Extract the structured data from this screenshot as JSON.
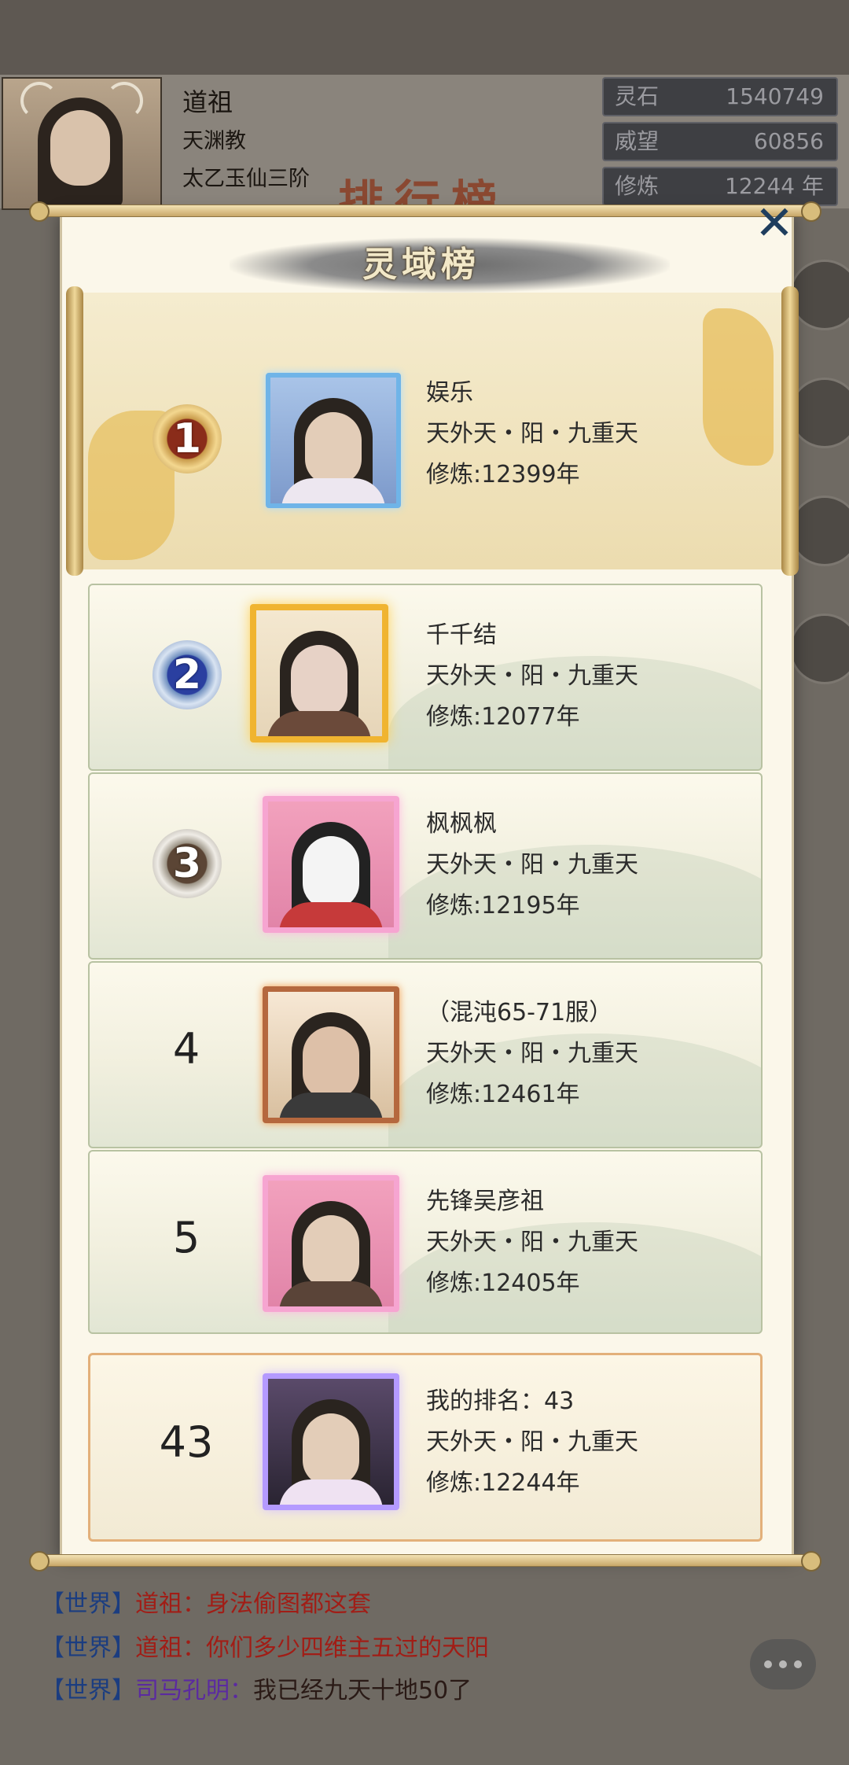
{
  "player": {
    "name": "道祖",
    "sect": "天渊教",
    "realm": "太乙玉仙三阶",
    "resources": [
      {
        "label": "灵石",
        "value": "1540749"
      },
      {
        "label": "威望",
        "value": "60856"
      },
      {
        "label": "修炼",
        "value": "12244 年"
      }
    ]
  },
  "background_title": "排行榜",
  "modal": {
    "title": "灵域榜",
    "close_icon": "close-x-icon",
    "entries": [
      {
        "rank": "1",
        "name": "娱乐",
        "realm": "天外天・阳・九重天",
        "cultivation": "修炼:12399年"
      },
      {
        "rank": "2",
        "name": "千千结",
        "realm": "天外天・阳・九重天",
        "cultivation": "修炼:12077年"
      },
      {
        "rank": "3",
        "name": "枫枫枫",
        "realm": "天外天・阳・九重天",
        "cultivation": "修炼:12195年"
      },
      {
        "rank": "4",
        "name": "（混沌65-71服）",
        "realm": "天外天・阳・九重天",
        "cultivation": "修炼:12461年"
      },
      {
        "rank": "5",
        "name": "先锋吴彦祖",
        "realm": "天外天・阳・九重天",
        "cultivation": "修炼:12405年"
      }
    ],
    "my_entry": {
      "rank": "43",
      "name": "我的排名：43",
      "realm": "天外天・阳・九重天",
      "cultivation": "修炼:12244年"
    }
  },
  "chat": [
    {
      "channel": "【世界】",
      "sender": "道祖：",
      "message": "身法偷图都这套",
      "sender_color": "#a11d16"
    },
    {
      "channel": "【世界】",
      "sender": "道祖：",
      "message": "你们多少四维主五过的天阳",
      "sender_color": "#a11d16"
    },
    {
      "channel": "【世界】",
      "sender": "司马孔明：",
      "message": "我已经九天十地50了",
      "sender_color": "#5b2aa0"
    }
  ],
  "colors": {
    "accent": "#c7a560",
    "close": "#1f3e5e",
    "chat_channel": "#1b3d80"
  }
}
